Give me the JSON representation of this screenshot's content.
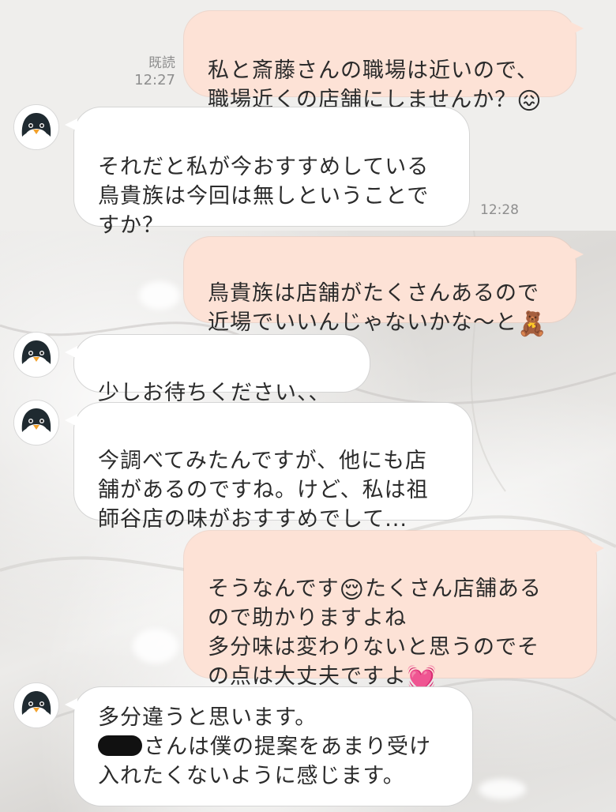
{
  "messages": [
    {
      "side": "out",
      "text": "私と斎藤さんの職場は近いので、\n職場近くの店舗にしませんか？",
      "emoji": "😖",
      "read": "既読",
      "time": "12:27"
    },
    {
      "side": "in",
      "text": "それだと私が今おすすめしている\n鳥貴族は今回は無しということで\nすか？",
      "time": "12:28"
    },
    {
      "side": "out",
      "text": "鳥貴族は店舗がたくさんあるので\n近場でいいんじゃないかな〜と",
      "emoji": "🧸"
    },
    {
      "side": "in",
      "text": "少しお待ちください、、"
    },
    {
      "side": "in",
      "text": "今調べてみたんですが、他にも店\n舗があるのですね。けど、私は祖\n師谷店の味がおすすめでして..."
    },
    {
      "side": "out",
      "part1": "そうなんです",
      "emoji_mid": "😌",
      "part2": "たくさん店舗ある\nので助かりますよね\n多分味は変わりないと思うのでそ\nの点は大丈夫ですよ",
      "emoji": "💓"
    },
    {
      "side": "in",
      "line1": "多分違うと思います。",
      "line2_suffix": "さんは僕の提案をあまり受け",
      "line3": "入れたくないように感じます。"
    }
  ]
}
